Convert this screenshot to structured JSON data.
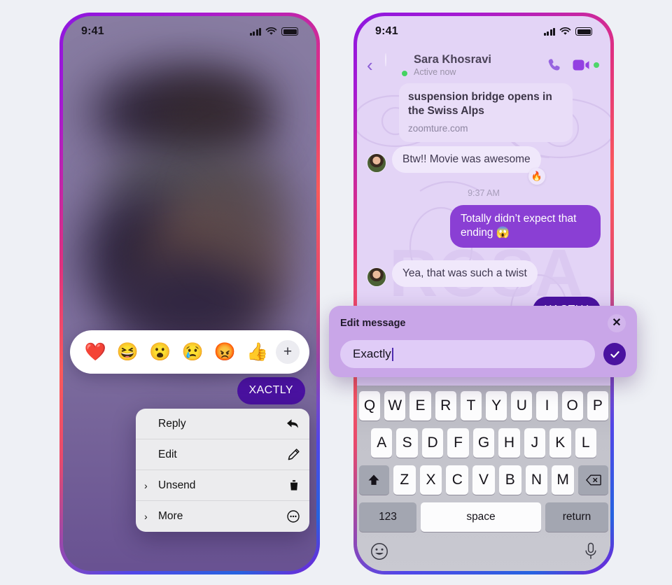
{
  "theme": {
    "accent_purple": "#8a3fd4",
    "deep_purple": "#4a12a0",
    "chat_bg": "#e3d4f6",
    "page_bg": "#eef0f5",
    "online_green": "#44d362"
  },
  "left_phone": {
    "status": {
      "time": "9:41",
      "signal_icon": "cellular-bars-icon",
      "wifi_icon": "wifi-icon",
      "battery_icon": "battery-icon"
    },
    "reaction_bar": {
      "emojis": [
        {
          "name": "heart-reaction",
          "glyph": "❤️"
        },
        {
          "name": "laughing-reaction",
          "glyph": "😆"
        },
        {
          "name": "surprised-reaction",
          "glyph": "😮"
        },
        {
          "name": "crying-reaction",
          "glyph": "😢"
        },
        {
          "name": "angry-reaction",
          "glyph": "😡"
        },
        {
          "name": "thumbsup-reaction",
          "glyph": "👍"
        }
      ],
      "add_label": "+"
    },
    "selected_message": "XACTLY",
    "context_menu": [
      {
        "label": "Reply",
        "icon": "reply-arrow-icon",
        "caret": ""
      },
      {
        "label": "Edit",
        "icon": "pencil-icon",
        "caret": ""
      },
      {
        "label": "Unsend",
        "icon": "trash-icon",
        "caret": "›"
      },
      {
        "label": "More",
        "icon": "more-circle-icon",
        "caret": "›"
      }
    ]
  },
  "right_phone": {
    "status": {
      "time": "9:41",
      "signal_icon": "cellular-bars-icon",
      "wifi_icon": "wifi-icon",
      "battery_icon": "battery-icon"
    },
    "header": {
      "back_icon": "back-chevron-icon",
      "avatar": "contact-avatar",
      "name": "Sara Khosravi",
      "status": "Active now",
      "call_icon": "phone-call-icon",
      "video_icon": "video-camera-icon"
    },
    "link_preview": {
      "title": "suspension bridge opens in the Swiss Alps",
      "url": "zoomture.com"
    },
    "messages": [
      {
        "from": "them",
        "text": "Btw!! Movie was awesome",
        "reaction": "🔥"
      },
      {
        "from": "me",
        "text": "Totally didn’t expect that ending 😱"
      },
      {
        "from": "them",
        "text": "Yea, that was such a twist"
      },
      {
        "from": "me",
        "text": "XACTLY"
      }
    ],
    "timestamp": "9:37 AM",
    "edit_dialog": {
      "title": "Edit message",
      "close_label": "✕",
      "input_value": "Exactly",
      "input_placeholder": "Edit message",
      "confirm_icon": "checkmark-icon"
    },
    "keyboard": {
      "row1": [
        "Q",
        "W",
        "E",
        "R",
        "T",
        "Y",
        "U",
        "I",
        "O",
        "P"
      ],
      "row2": [
        "A",
        "S",
        "D",
        "F",
        "G",
        "H",
        "J",
        "K",
        "L"
      ],
      "row3": [
        "Z",
        "X",
        "C",
        "V",
        "B",
        "N",
        "M"
      ],
      "shift_icon": "shift-arrow-icon",
      "backspace_icon": "backspace-icon",
      "numbers_label": "123",
      "space_label": "space",
      "return_label": "return",
      "emoji_icon": "emoji-keyboard-icon",
      "mic_icon": "microphone-icon"
    }
  }
}
